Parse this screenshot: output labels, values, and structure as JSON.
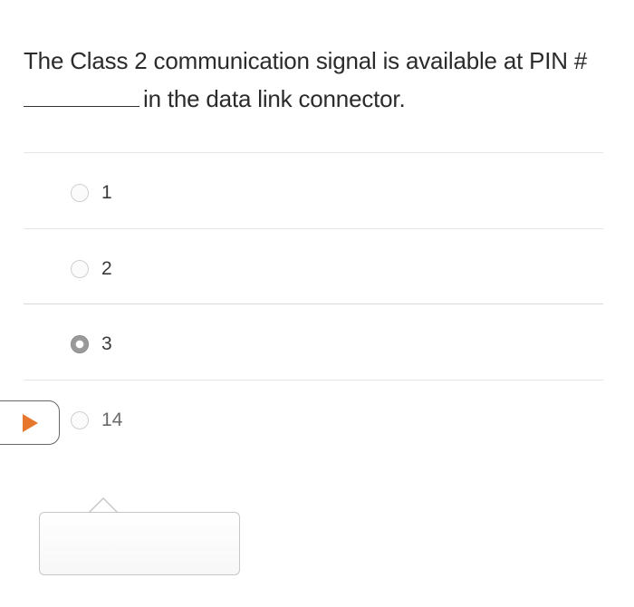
{
  "question": {
    "line1": "The Class 2 communication signal is available at PIN #",
    "line2": "in the data link connector."
  },
  "options": [
    {
      "label": "1",
      "selected": false
    },
    {
      "label": "2",
      "selected": false
    },
    {
      "label": "3",
      "selected": true
    },
    {
      "label": "14",
      "selected": false
    }
  ],
  "colors": {
    "play_accent": "#e8772e",
    "divider": "#e6e6e6",
    "selected_radio": "#9a9a9a"
  },
  "icons": {
    "play": "play-icon",
    "radio": "radio-icon"
  }
}
